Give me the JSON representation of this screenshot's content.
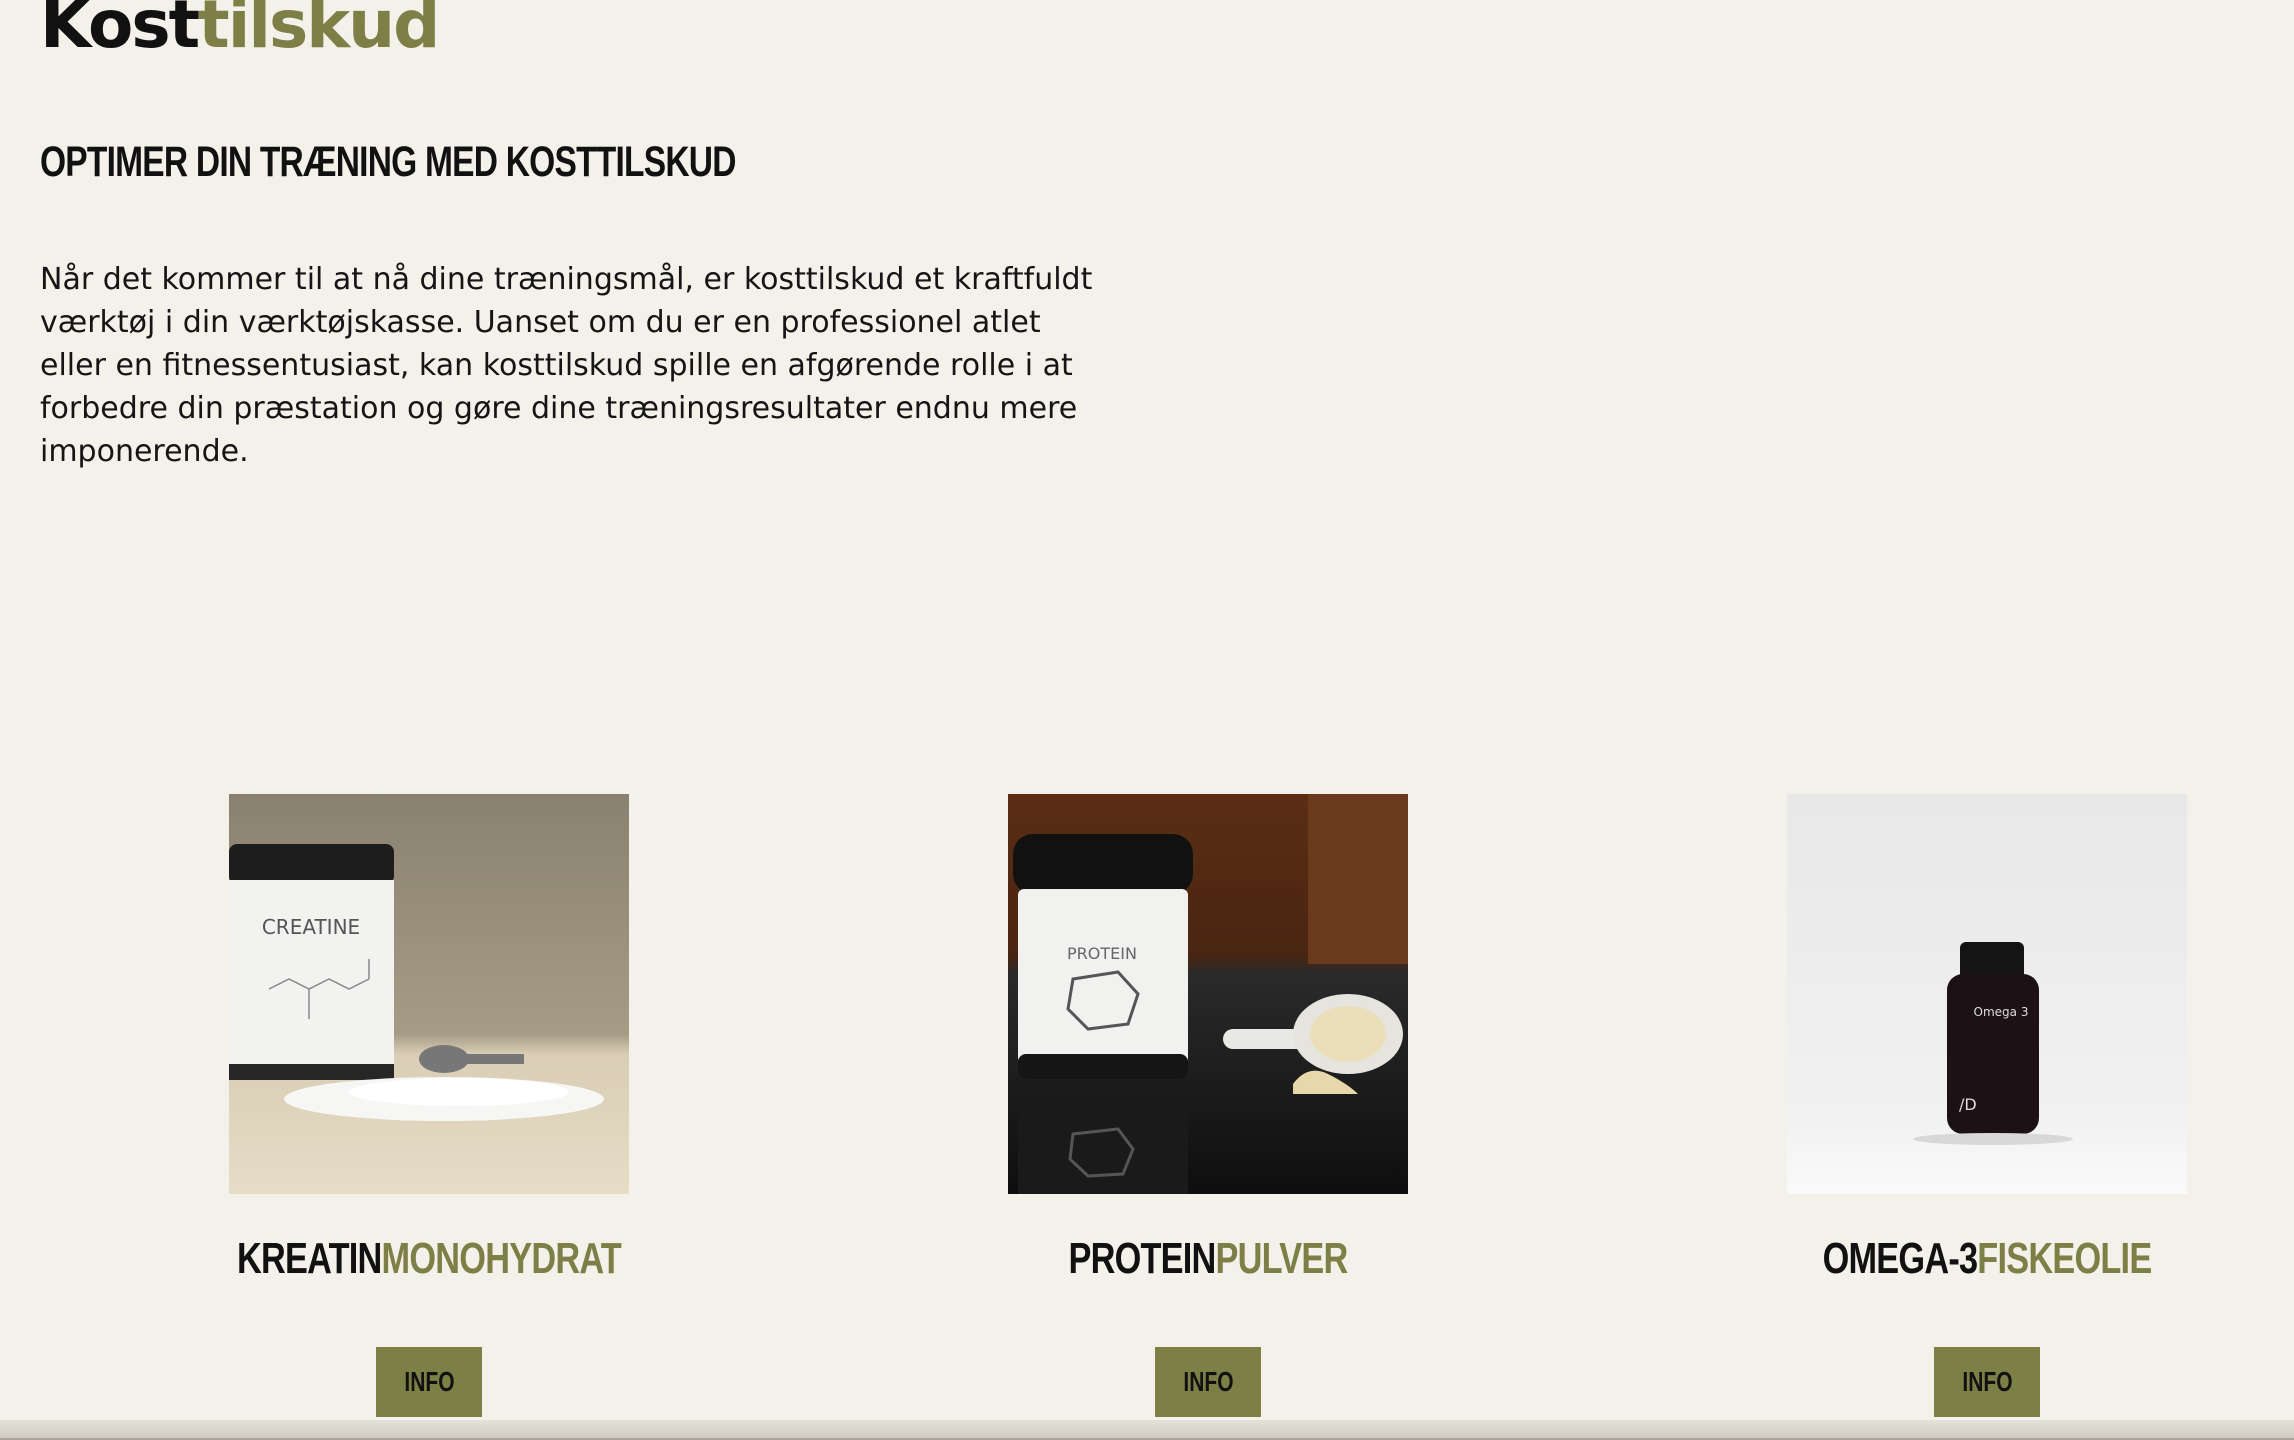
{
  "header": {
    "title_dark": "Kost",
    "title_accent": "tilskud",
    "subheading": "OPTIMER DIN TRÆNING MED KOSTTILSKUD"
  },
  "intro": {
    "text": "Når det kommer til at nå dine træningsmål, er kosttilskud et kraftfuldt værktøj i din værktøjskasse. Uanset om du er en professionel atlet eller en fitnessentusiast, kan kosttilskud spille en afgørende rolle i at forbedre din præstation og gøre dine træningsresultater endnu mere imponerende."
  },
  "products": [
    {
      "name_dark": "KREATIN",
      "name_accent": "MONOHYDRAT",
      "button": "INFO",
      "jar_label": "CREATINE"
    },
    {
      "name_dark": "PROTEIN",
      "name_accent": "PULVER",
      "button": "INFO",
      "jar_label": "PROTEIN"
    },
    {
      "name_dark": "OMEGA-3",
      "name_accent": "FISKEOLIE",
      "button": "INFO",
      "jar_label": "Omega 3"
    }
  ],
  "colors": {
    "background": "#f4f1ea",
    "accent": "#7c7f46",
    "text": "#111111"
  }
}
